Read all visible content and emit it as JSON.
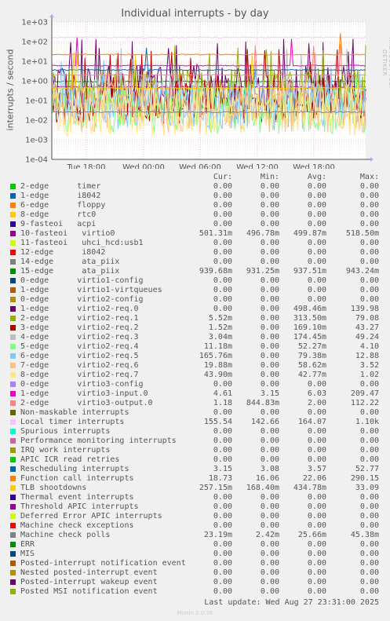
{
  "chart_data": {
    "type": "line",
    "title": "Individual interrupts - by day",
    "ylabel": "interrupts / second",
    "yscale": "log",
    "ylim": [
      0.0001,
      1000
    ],
    "y_ticks": [
      "1e+03",
      "1e+02",
      "1e+01",
      "1e+00",
      "1e-01",
      "1e-02",
      "1e-03",
      "1e-04"
    ],
    "x_ticks": [
      "Tue 18:00",
      "Wed 00:00",
      "Wed 06:00",
      "Wed 12:00",
      "Wed 18:00"
    ],
    "grid": true,
    "legend_columns": [
      "Cur:",
      "Min:",
      "Avg:",
      "Max:"
    ],
    "series": [
      {
        "name": "2-edge      timer",
        "color": "#00cc00",
        "cur": "0.00",
        "min": "0.00",
        "avg": "0.00",
        "max": "0.00"
      },
      {
        "name": "1-edge      i8042",
        "color": "#0066b3",
        "cur": "0.00",
        "min": "0.00",
        "avg": "0.00",
        "max": "0.00"
      },
      {
        "name": "6-edge      floppy",
        "color": "#ff8000",
        "cur": "0.00",
        "min": "0.00",
        "avg": "0.00",
        "max": "0.00"
      },
      {
        "name": "8-edge      rtc0",
        "color": "#ffcc00",
        "cur": "0.00",
        "min": "0.00",
        "avg": "0.00",
        "max": "0.00"
      },
      {
        "name": "9-fasteoi   acpi",
        "color": "#330099",
        "cur": "0.00",
        "min": "0.00",
        "avg": "0.00",
        "max": "0.00"
      },
      {
        "name": "10-fasteoi   virtio0",
        "color": "#990099",
        "cur": "501.31m",
        "min": "496.78m",
        "avg": "499.87m",
        "max": "518.50m"
      },
      {
        "name": "11-fasteoi   uhci_hcd:usb1",
        "color": "#ccff00",
        "cur": "0.00",
        "min": "0.00",
        "avg": "0.00",
        "max": "0.00"
      },
      {
        "name": "12-edge      i8042",
        "color": "#ff0000",
        "cur": "0.00",
        "min": "0.00",
        "avg": "0.00",
        "max": "0.00"
      },
      {
        "name": "14-edge      ata_piix",
        "color": "#808080",
        "cur": "0.00",
        "min": "0.00",
        "avg": "0.00",
        "max": "0.00"
      },
      {
        "name": "15-edge      ata_piix",
        "color": "#008f00",
        "cur": "939.68m",
        "min": "931.25m",
        "avg": "937.51m",
        "max": "943.24m"
      },
      {
        "name": "0-edge      virtio1-config",
        "color": "#00487d",
        "cur": "0.00",
        "min": "0.00",
        "avg": "0.00",
        "max": "0.00"
      },
      {
        "name": "1-edge      virtio1-virtqueues",
        "color": "#b35a00",
        "cur": "0.00",
        "min": "0.00",
        "avg": "0.00",
        "max": "0.00"
      },
      {
        "name": "0-edge      virtio2-config",
        "color": "#b38f00",
        "cur": "0.00",
        "min": "0.00",
        "avg": "0.00",
        "max": "0.00"
      },
      {
        "name": "1-edge      virtio2-req.0",
        "color": "#6b006b",
        "cur": "0.00",
        "min": "0.00",
        "avg": "498.46m",
        "max": "139.98"
      },
      {
        "name": "2-edge      virtio2-req.1",
        "color": "#8fb300",
        "cur": "5.52m",
        "min": "0.00",
        "avg": "313.50m",
        "max": "79.08"
      },
      {
        "name": "3-edge      virtio2-req.2",
        "color": "#b30000",
        "cur": "1.52m",
        "min": "0.00",
        "avg": "169.10m",
        "max": "43.27"
      },
      {
        "name": "4-edge      virtio2-req.3",
        "color": "#bebebe",
        "cur": "3.04m",
        "min": "0.00",
        "avg": "174.45m",
        "max": "49.24"
      },
      {
        "name": "5-edge      virtio2-req.4",
        "color": "#80ff80",
        "cur": "11.18m",
        "min": "0.00",
        "avg": "52.27m",
        "max": "4.10"
      },
      {
        "name": "6-edge      virtio2-req.5",
        "color": "#80c9ff",
        "cur": "165.76m",
        "min": "0.00",
        "avg": "79.38m",
        "max": "12.88"
      },
      {
        "name": "7-edge      virtio2-req.6",
        "color": "#ffc080",
        "cur": "19.88m",
        "min": "0.00",
        "avg": "58.62m",
        "max": "3.52"
      },
      {
        "name": "8-edge      virtio2-req.7",
        "color": "#ffe680",
        "cur": "43.90m",
        "min": "0.00",
        "avg": "42.77m",
        "max": "1.02"
      },
      {
        "name": "0-edge      virtio3-config",
        "color": "#aa80ff",
        "cur": "0.00",
        "min": "0.00",
        "avg": "0.00",
        "max": "0.00"
      },
      {
        "name": "1-edge      virtio3-input.0",
        "color": "#ee00cc",
        "cur": "4.61",
        "min": "3.15",
        "avg": "6.03",
        "max": "209.47"
      },
      {
        "name": "2-edge      virtio3-output.0",
        "color": "#ff8080",
        "cur": "1.18",
        "min": "844.83m",
        "avg": "2.00",
        "max": "112.22"
      },
      {
        "name": "Non-maskable interrupts",
        "color": "#666600",
        "cur": "0.00",
        "min": "0.00",
        "avg": "0.00",
        "max": "0.00"
      },
      {
        "name": "Local timer interrupts",
        "color": "#ffbfff",
        "cur": "155.54",
        "min": "142.66",
        "avg": "164.07",
        "max": "1.10k"
      },
      {
        "name": "Spurious interrupts",
        "color": "#00ffcc",
        "cur": "0.00",
        "min": "0.00",
        "avg": "0.00",
        "max": "0.00"
      },
      {
        "name": "Performance monitoring interrupts",
        "color": "#cc6699",
        "cur": "0.00",
        "min": "0.00",
        "avg": "0.00",
        "max": "0.00"
      },
      {
        "name": "IRQ work interrupts",
        "color": "#999900",
        "cur": "0.00",
        "min": "0.00",
        "avg": "0.00",
        "max": "0.00"
      },
      {
        "name": "APIC ICR read retries",
        "color": "#00cc00",
        "cur": "0.00",
        "min": "0.00",
        "avg": "0.00",
        "max": "0.00"
      },
      {
        "name": "Rescheduling interrupts",
        "color": "#0066b3",
        "cur": "3.15",
        "min": "3.08",
        "avg": "3.57",
        "max": "52.77"
      },
      {
        "name": "Function call interrupts",
        "color": "#ff8000",
        "cur": "18.73",
        "min": "16.06",
        "avg": "22.06",
        "max": "290.15"
      },
      {
        "name": "TLB shootdowns",
        "color": "#ffcc00",
        "cur": "257.15m",
        "min": "168.40m",
        "avg": "434.78m",
        "max": "33.09"
      },
      {
        "name": "Thermal event interrupts",
        "color": "#330099",
        "cur": "0.00",
        "min": "0.00",
        "avg": "0.00",
        "max": "0.00"
      },
      {
        "name": "Threshold APIC interrupts",
        "color": "#990099",
        "cur": "0.00",
        "min": "0.00",
        "avg": "0.00",
        "max": "0.00"
      },
      {
        "name": "Deferred Error APIC interrupts",
        "color": "#ccff00",
        "cur": "0.00",
        "min": "0.00",
        "avg": "0.00",
        "max": "0.00"
      },
      {
        "name": "Machine check exceptions",
        "color": "#ff0000",
        "cur": "0.00",
        "min": "0.00",
        "avg": "0.00",
        "max": "0.00"
      },
      {
        "name": "Machine check polls",
        "color": "#808080",
        "cur": "23.19m",
        "min": "2.42m",
        "avg": "25.66m",
        "max": "45.38m"
      },
      {
        "name": "ERR",
        "color": "#008f00",
        "cur": "0.00",
        "min": "0.00",
        "avg": "0.00",
        "max": "0.00"
      },
      {
        "name": "MIS",
        "color": "#00487d",
        "cur": "0.00",
        "min": "0.00",
        "avg": "0.00",
        "max": "0.00"
      },
      {
        "name": "Posted-interrupt notification event",
        "color": "#b35a00",
        "cur": "0.00",
        "min": "0.00",
        "avg": "0.00",
        "max": "0.00"
      },
      {
        "name": "Nested posted-interrupt event",
        "color": "#b38f00",
        "cur": "0.00",
        "min": "0.00",
        "avg": "0.00",
        "max": "0.00"
      },
      {
        "name": "Posted-interrupt wakeup event",
        "color": "#6b006b",
        "cur": "0.00",
        "min": "0.00",
        "avg": "0.00",
        "max": "0.00"
      },
      {
        "name": "Posted MSI notification event",
        "color": "#8fb300",
        "cur": "0.00",
        "min": "0.00",
        "avg": "0.00",
        "max": "0.00"
      }
    ]
  },
  "watermark": "RRDTOOL / TOBI OETIKER",
  "last_update": "Last update: Wed Aug 27 23:31:00 2025",
  "footer": "Munin 2.0.76"
}
